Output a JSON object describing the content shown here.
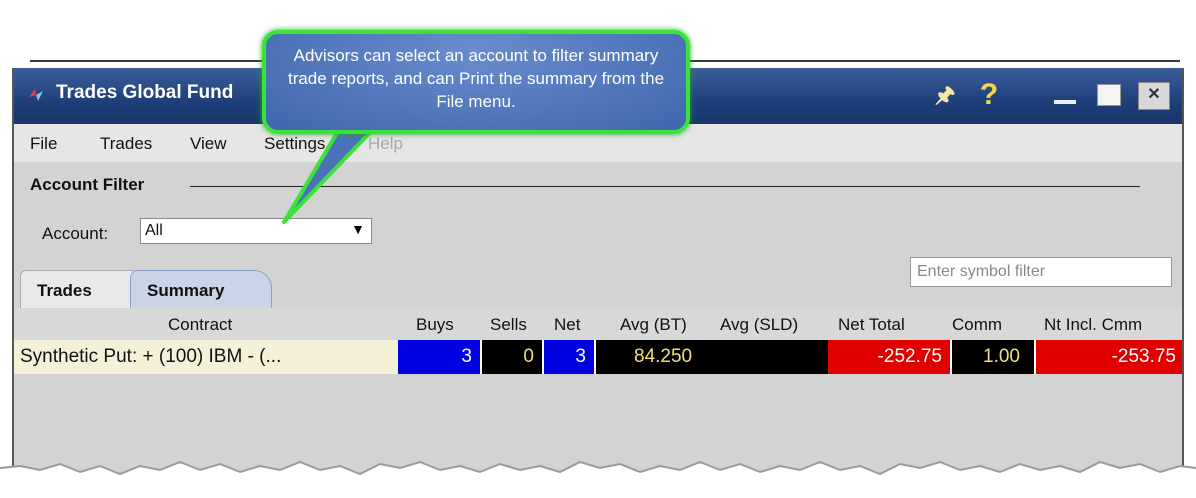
{
  "window": {
    "title": "Trades Global Fund"
  },
  "menu": {
    "file": "File",
    "trades": "Trades",
    "view": "View",
    "settings": "Settings",
    "help": "Help"
  },
  "callout": {
    "text": "Advisors can select an account to filter summary trade reports, and can Print the summary from the File menu."
  },
  "account_filter": {
    "title": "Account Filter",
    "account_label": "Account:",
    "account_value": "All"
  },
  "tabs": {
    "trades": "Trades",
    "summary": "Summary"
  },
  "symbol_filter": {
    "placeholder": "Enter symbol filter"
  },
  "table": {
    "headers": {
      "contract": "Contract",
      "buys": "Buys",
      "sells": "Sells",
      "net": "Net",
      "avg_bt": "Avg (BT)",
      "avg_sld": "Avg (SLD)",
      "net_total": "Net Total",
      "comm": "Comm",
      "nt_incl_cmm": "Nt Incl. Cmm"
    },
    "rows": [
      {
        "contract": "Synthetic Put:  + (100) IBM - (...",
        "buys": "3",
        "sells": "0",
        "net": "3",
        "avg_bt": "84.250",
        "avg_sld": "",
        "net_total": "-252.75",
        "comm": "1.00",
        "nt_incl_cmm": "-253.75"
      }
    ]
  },
  "colors": {
    "titlebar": "#1f3f7a",
    "callout_border": "#39e33a",
    "buys_bg": "#0000e0",
    "loss_bg": "#e00000",
    "cell_black": "#000000",
    "avg_text": "#f0e070"
  }
}
